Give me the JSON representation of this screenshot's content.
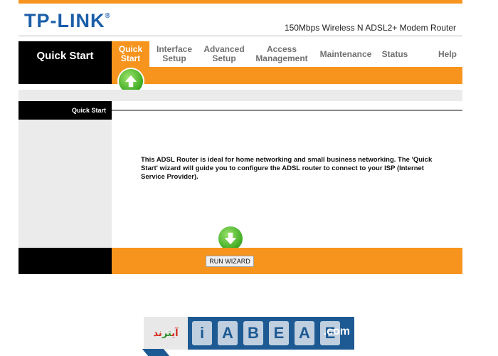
{
  "brand": {
    "logo": "TP-LINK",
    "registered": "®",
    "model": "150Mbps Wireless N ADSL2+ Modem Router"
  },
  "nav": {
    "section_title": "Quick Start",
    "items": [
      {
        "label": "Quick Start",
        "active": true
      },
      {
        "label": "Interface Setup",
        "active": false
      },
      {
        "label": "Advanced Setup",
        "active": false
      },
      {
        "label": "Access Management",
        "active": false
      },
      {
        "label": "Maintenance",
        "active": false
      },
      {
        "label": "Status",
        "active": false
      },
      {
        "label": "Help",
        "active": false
      }
    ]
  },
  "panel": {
    "label": "Quick Start",
    "description": "This ADSL Router is ideal for home networking and small business networking. The 'Quick Start' wizard will guide you to configure the ADSL router to connect to your ISP (Internet Service Provider)."
  },
  "actions": {
    "run_wizard": "RUN WIZARD"
  },
  "watermark": {
    "farsi_red": "آی",
    "farsi_green": "تر",
    "farsi_red2": "ند",
    "domain": ".com"
  },
  "colors": {
    "accent": "#f7941d",
    "dark": "#000000",
    "brand": "#1a5ea8",
    "arrow": "#3daa22"
  },
  "icons": {
    "up": "arrow-up-icon",
    "down": "arrow-down-icon"
  }
}
